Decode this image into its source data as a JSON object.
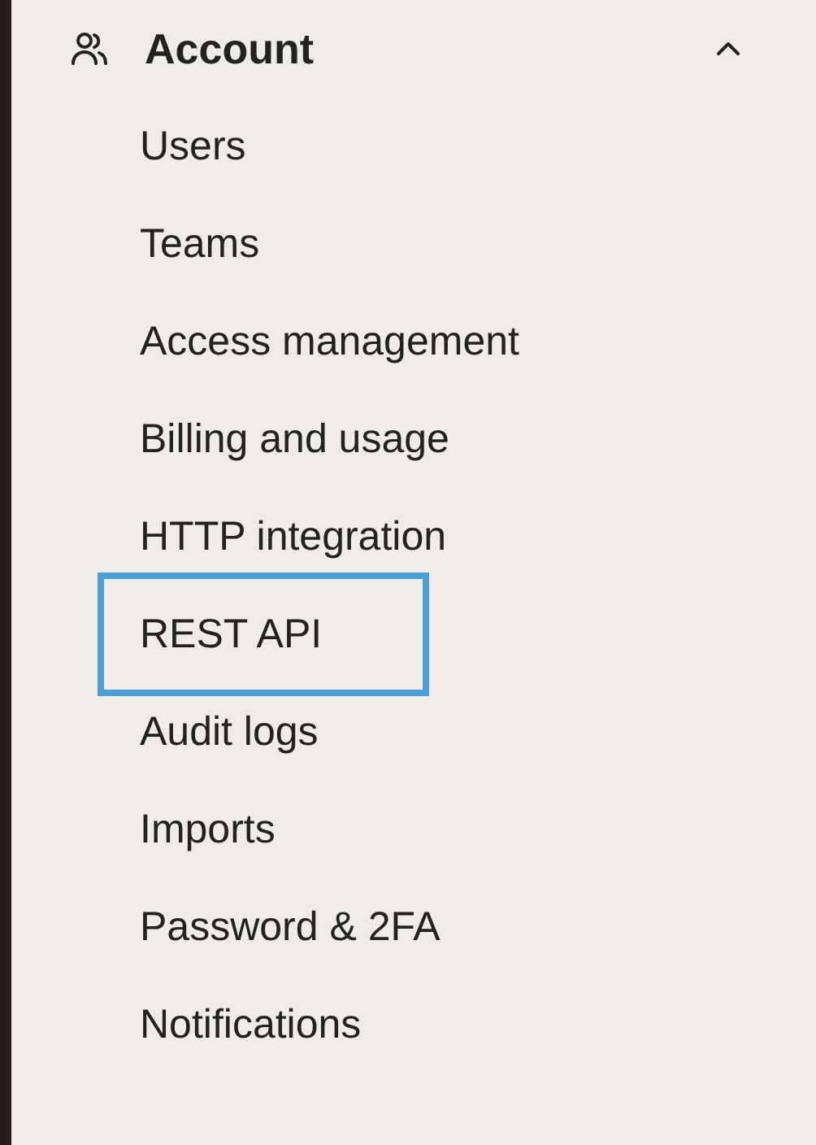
{
  "section": {
    "title": "Account",
    "expanded": true,
    "items": [
      {
        "label": "Users",
        "selected": false
      },
      {
        "label": "Teams",
        "selected": false
      },
      {
        "label": "Access management",
        "selected": false
      },
      {
        "label": "Billing and usage",
        "selected": false
      },
      {
        "label": "HTTP integration",
        "selected": false
      },
      {
        "label": "REST API",
        "selected": true
      },
      {
        "label": "Audit logs",
        "selected": false
      },
      {
        "label": "Imports",
        "selected": false
      },
      {
        "label": "Password & 2FA",
        "selected": false
      },
      {
        "label": "Notifications",
        "selected": false
      }
    ]
  }
}
